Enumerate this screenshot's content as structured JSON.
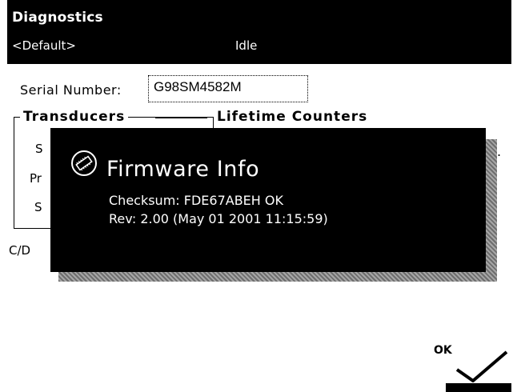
{
  "header": {
    "title": "Diagnostics",
    "profile": "<Default>",
    "status": "Idle"
  },
  "serial": {
    "label": "Serial Number:",
    "value": "G98SM4582M"
  },
  "background": {
    "transducers_title": "Transducers",
    "lifetime_title": "Lifetime Counters",
    "row1": "S",
    "row2": "Pr",
    "row3": "S",
    "cd_label": "C/D",
    "trailing_dot": "."
  },
  "dialog": {
    "title": "Firmware Info",
    "checksum_line": "Checksum: FDE67ABEH OK",
    "rev_line": "Rev: 2.00 (May 01 2001 11:15:59)"
  },
  "footer": {
    "ok_label": "OK"
  },
  "icons": {
    "firmware": "chip-icon",
    "ok": "checkmark-icon"
  }
}
